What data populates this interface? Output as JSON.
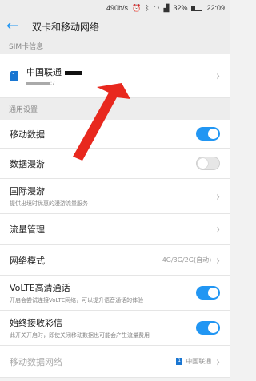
{
  "status_bar": {
    "speed": "490b/s",
    "battery_percent_text": "32%",
    "battery_level": 0.32,
    "time": "22:09"
  },
  "header": {
    "title": "双卡和移动网络"
  },
  "sim_section": {
    "header": "SIM卡信息",
    "sim1": {
      "slot": "1",
      "carrier": "中国联通",
      "number_suffix": ":7"
    }
  },
  "general_section": {
    "header": "通用设置",
    "items": [
      {
        "label": "移动数据",
        "toggle": "on"
      },
      {
        "label": "数据漫游",
        "toggle": "off"
      },
      {
        "label": "国际漫游",
        "sub": "提供出境时优惠的漫游流量服务"
      },
      {
        "label": "流量管理"
      },
      {
        "label": "网络模式",
        "value": "4G/3G/2G(自动)"
      },
      {
        "label": "VoLTE高清通话",
        "sub": "开启会尝试连接VoLTE网络，可以提升语音通话的体验",
        "toggle": "on"
      },
      {
        "label": "始终接收彩信",
        "sub": "此开关开启时，即使关闭移动数据也可能会产生流量费用",
        "toggle": "on"
      },
      {
        "label": "移动数据网络",
        "value": "中国联通",
        "slot": "1"
      }
    ]
  },
  "annotation": {
    "color": "#e8281e"
  }
}
